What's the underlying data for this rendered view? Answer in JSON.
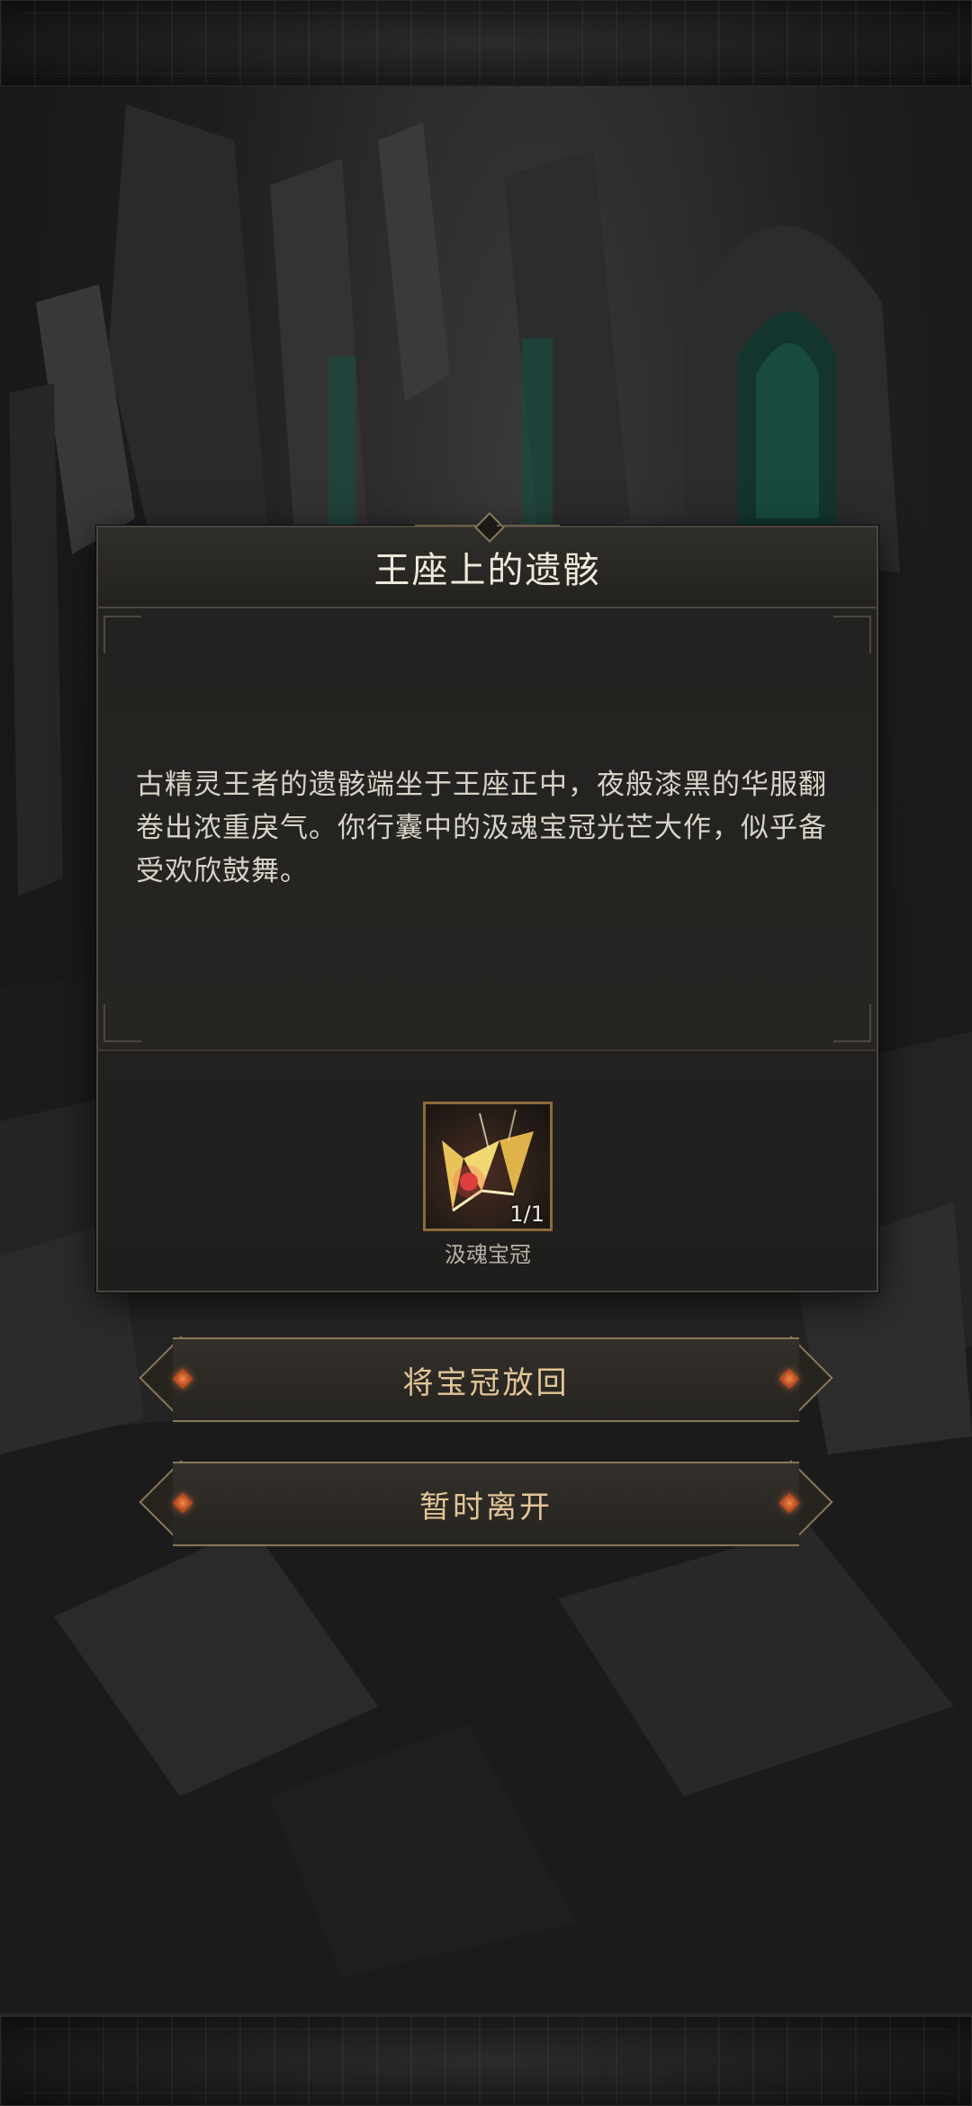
{
  "dialog": {
    "title": "王座上的遗骸",
    "description": "古精灵王者的遗骸端坐于王座正中，夜般漆黑的华服翻卷出浓重戾气。你行囊中的汲魂宝冠光芒大作，似乎备受欢欣鼓舞。"
  },
  "item": {
    "name": "汲魂宝冠",
    "count": "1/1",
    "icon": "crown-icon"
  },
  "actions": {
    "return_label": "将宝冠放回",
    "leave_label": "暂时离开"
  },
  "colors": {
    "button_text": "#e2c597",
    "gem_accent": "#e0703a",
    "item_border": "#8c6b3a"
  }
}
